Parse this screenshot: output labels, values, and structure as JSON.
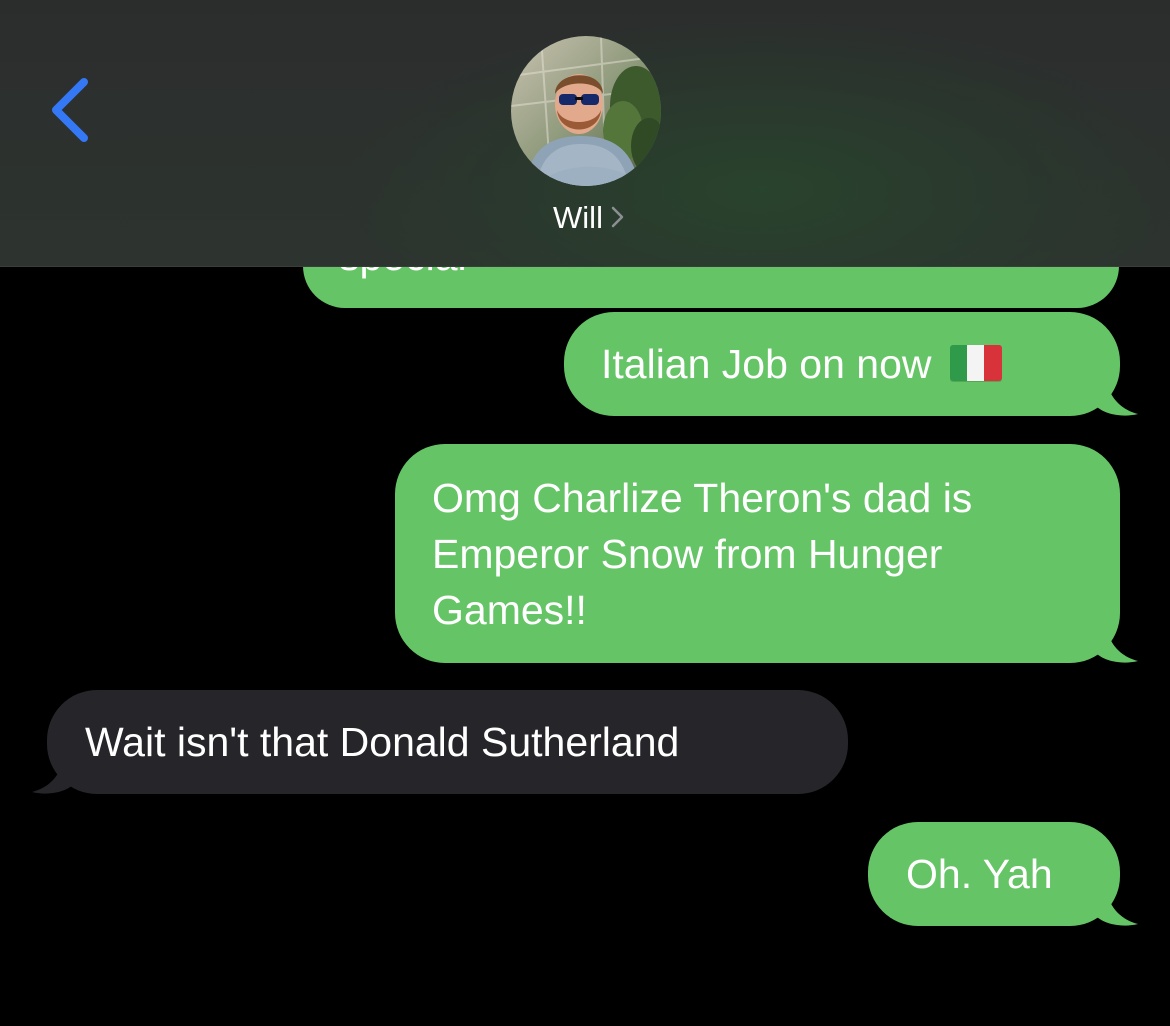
{
  "header": {
    "contact_name": "Will",
    "back_icon": "chevron-left-icon",
    "disclosure_icon": "chevron-right-icon",
    "accent_color": "#3478f6"
  },
  "messages": [
    {
      "direction": "sent",
      "text": "special",
      "partially_hidden": true
    },
    {
      "direction": "sent",
      "text": "Italian Job on now",
      "emoji": "flag-italy"
    },
    {
      "direction": "sent",
      "lines": [
        "Omg Charlize Theron's dad is",
        "Emperor Snow from Hunger",
        "Games!!"
      ]
    },
    {
      "direction": "received",
      "text": "Wait isn't that Donald Sutherland"
    },
    {
      "direction": "sent",
      "text": "Oh. Yah"
    }
  ],
  "colors": {
    "sent_bubble": "#65c466",
    "received_bubble": "#26252a",
    "background": "#000000"
  }
}
